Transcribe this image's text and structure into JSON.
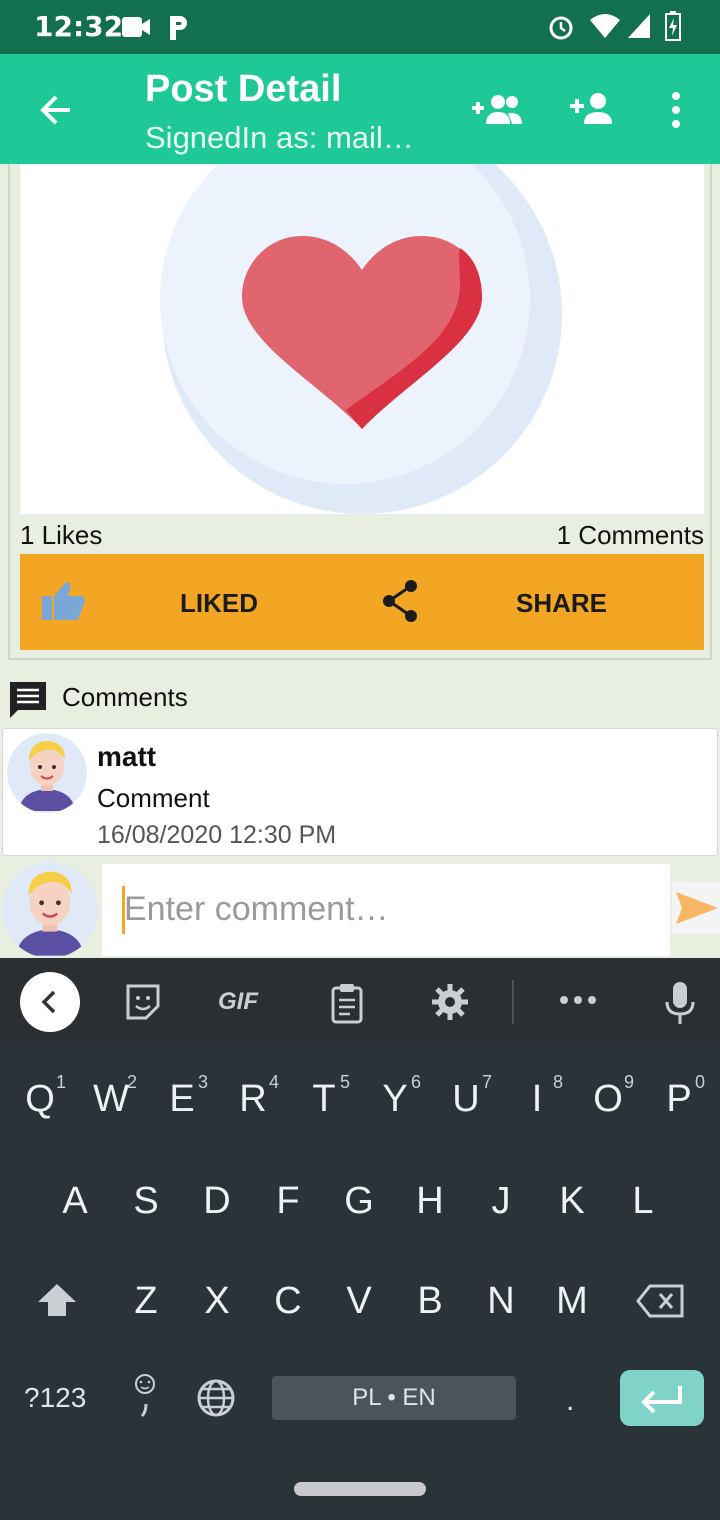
{
  "status_bar": {
    "time": "12:32",
    "icons": [
      "video-icon",
      "p-app-icon",
      "alarm-icon",
      "wifi-icon",
      "signal-icon",
      "battery-charging-icon"
    ]
  },
  "app_bar": {
    "title": "Post Detail",
    "subtitle": "SignedIn as: mail…",
    "back_icon": "back-arrow-icon",
    "actions": [
      "add-group-icon",
      "add-person-icon",
      "more-vert-icon"
    ]
  },
  "post": {
    "image_icon": "heart-icon",
    "likes_text": "1 Likes",
    "comments_text": "1 Comments",
    "like_button": "LIKED",
    "share_button": "SHARE"
  },
  "comments_section": {
    "header": "Comments",
    "items": [
      {
        "author": "matt",
        "text": "Comment",
        "date": "16/08/2020 12:30 PM"
      }
    ]
  },
  "comment_input": {
    "placeholder": "Enter comment…"
  },
  "keyboard": {
    "toolbar": [
      "back-chevron-icon",
      "sticker-icon",
      "GIF",
      "clipboard-icon",
      "settings-icon",
      "more-icon",
      "mic-icon"
    ],
    "gif_label": "GIF",
    "row1": [
      {
        "k": "Q",
        "n": "1"
      },
      {
        "k": "W",
        "n": "2"
      },
      {
        "k": "E",
        "n": "3"
      },
      {
        "k": "R",
        "n": "4"
      },
      {
        "k": "T",
        "n": "5"
      },
      {
        "k": "Y",
        "n": "6"
      },
      {
        "k": "U",
        "n": "7"
      },
      {
        "k": "I",
        "n": "8"
      },
      {
        "k": "O",
        "n": "9"
      },
      {
        "k": "P",
        "n": "0"
      }
    ],
    "row2": [
      "A",
      "S",
      "D",
      "F",
      "G",
      "H",
      "J",
      "K",
      "L"
    ],
    "row3": [
      "Z",
      "X",
      "C",
      "V",
      "B",
      "N",
      "M"
    ],
    "symbols_label": "?123",
    "period": ".",
    "space_label": "PL • EN"
  },
  "colors": {
    "status_bar": "#13704e",
    "app_bar": "#1ec997",
    "action_bar": "#f2a623",
    "keyboard": "#2a3338",
    "enter_key": "#7fd3c9"
  }
}
